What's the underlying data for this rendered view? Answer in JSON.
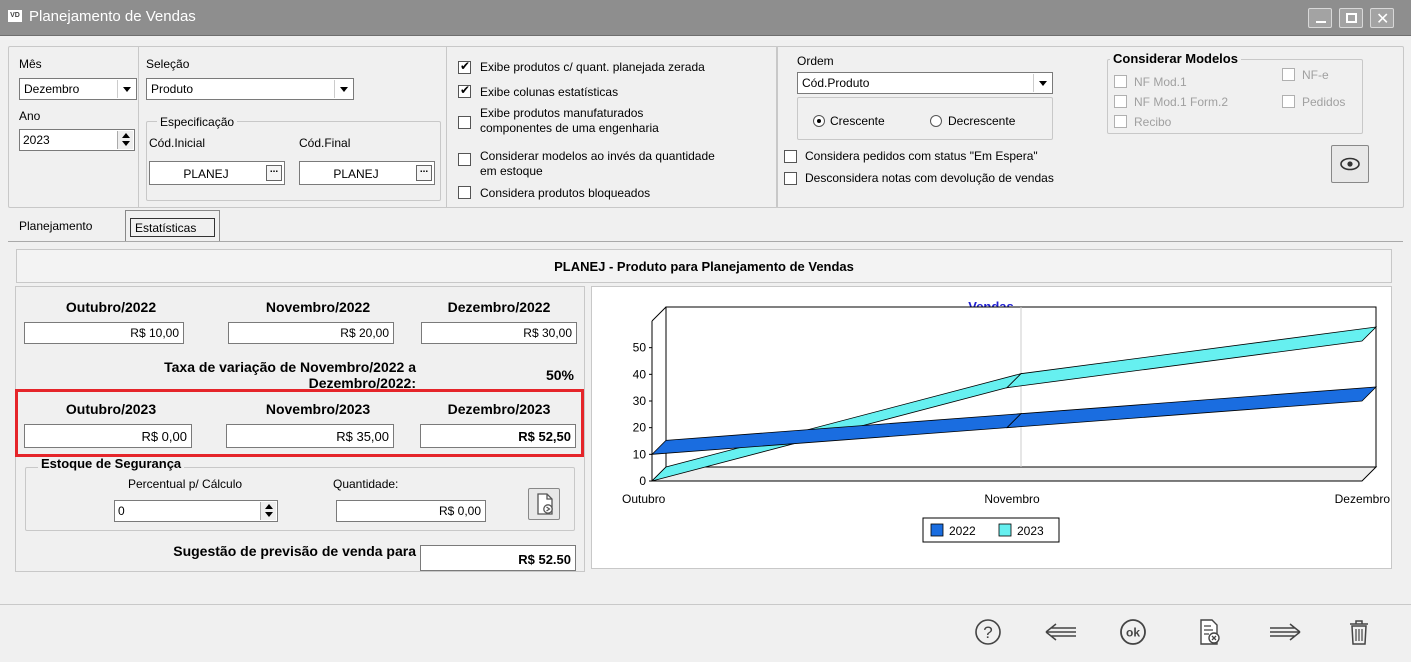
{
  "window": {
    "badge": "VD",
    "title": "Planejamento de Vendas"
  },
  "filters": {
    "mes_label": "Mês",
    "mes_value": "Dezembro",
    "ano_label": "Ano",
    "ano_value": "2023",
    "selecao_label": "Seleção",
    "selecao_value": "Produto",
    "especificacao_label": "Especificação",
    "cod_inicial_label": "Cód.Inicial",
    "cod_inicial_value": "PLANEJ",
    "cod_final_label": "Cód.Final",
    "cod_final_value": "PLANEJ"
  },
  "options": [
    {
      "label": "Exibe produtos c/ quant. planejada zerada",
      "checked": true
    },
    {
      "label": "Exibe colunas estatísticas",
      "checked": true
    },
    {
      "label1": "Exibe produtos manufaturados",
      "label2": "componentes de uma engenharia",
      "checked": false
    },
    {
      "label1": "Considerar modelos ao invés da quantidade",
      "label2": "em estoque",
      "checked": false
    },
    {
      "label": "Considera produtos bloqueados",
      "checked": false
    }
  ],
  "ordem": {
    "label": "Ordem",
    "value": "Cód.Produto",
    "crescente": "Crescente",
    "decrescente": "Decrescente",
    "selected": "Crescente",
    "pedidos_espera": "Considera pedidos com status \"Em Espera\"",
    "desconsidera_notas": "Desconsidera notas com devolução de vendas"
  },
  "modelos": {
    "title": "Considerar Modelos",
    "nf_mod1": "NF Mod.1",
    "nf_mod1_form2": "NF Mod.1 Form.2",
    "recibo": "Recibo",
    "nfe": "NF-e",
    "pedidos": "Pedidos"
  },
  "tabs": {
    "planejamento": "Planejamento",
    "estatisticas": "Estatísticas"
  },
  "product_title": "PLANEJ - Produto para Planejamento de Vendas",
  "prev_year": {
    "headers": [
      "Outubro/2022",
      "Novembro/2022",
      "Dezembro/2022"
    ],
    "values": [
      "R$ 10,00",
      "R$ 20,00",
      "R$ 30,00"
    ]
  },
  "taxa": {
    "label1": "Taxa de variação de Novembro/2022 a",
    "label2": "Dezembro/2022:",
    "value": "50%"
  },
  "curr_year": {
    "headers": [
      "Outubro/2023",
      "Novembro/2023",
      "Dezembro/2023"
    ],
    "values": [
      "R$ 0,00",
      "R$ 35,00",
      "R$ 52,50"
    ]
  },
  "estoque": {
    "title": "Estoque de Segurança",
    "percentual_label": "Percentual p/ Cálculo",
    "percentual_value": "0",
    "quantidade_label": "Quantidade:",
    "quantidade_value": "R$ 0,00"
  },
  "sugestao": {
    "label1": "Sugestão de previsão de venda para",
    "value": "R$ 52.50"
  },
  "chart_data": {
    "type": "line",
    "title": "Vendas",
    "categories": [
      "Outubro",
      "Novembro",
      "Dezembro"
    ],
    "series": [
      {
        "name": "2022",
        "values": [
          10,
          20,
          30
        ],
        "color": "#1a6de0"
      },
      {
        "name": "2023",
        "values": [
          0,
          35,
          52.5
        ],
        "color": "#66f0f0"
      }
    ],
    "y_ticks": [
      "0",
      "10",
      "20",
      "30",
      "40",
      "50"
    ],
    "ylim": [
      0,
      60
    ],
    "legend_position": "bottom"
  },
  "toolbar": {
    "icons": [
      "help-icon",
      "back-arrow-icon",
      "ok-icon",
      "cancel-doc-icon",
      "forward-arrow-icon",
      "trash-icon"
    ]
  }
}
